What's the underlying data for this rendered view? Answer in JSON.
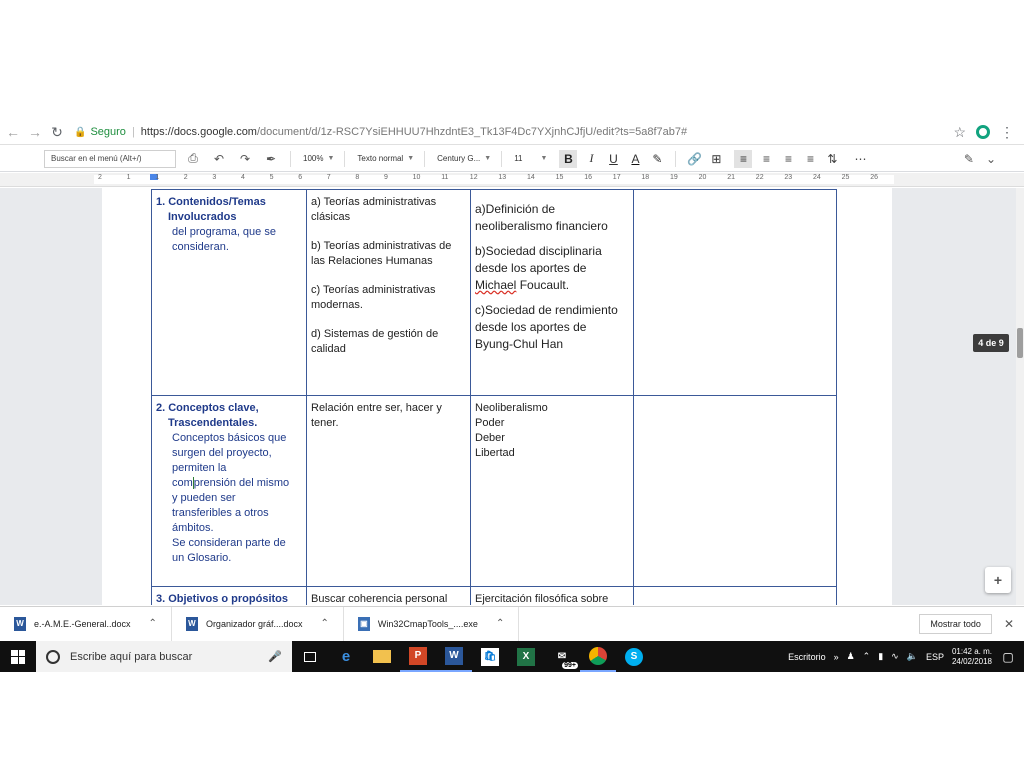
{
  "browser": {
    "secure_label": "Seguro",
    "url_prefix": "https://docs.google.com",
    "url_path": "/document/d/1z-RSC7YsiEHHUU7HhzdntE3_Tk13F4Dc7YXjnhCJfjU/edit?ts=5a8f7ab7#"
  },
  "toolbar": {
    "menu_search_placeholder": "Buscar en el menú (Alt+/)",
    "zoom": "100%",
    "style": "Texto normal",
    "font": "Century G...",
    "font_size": "11"
  },
  "ruler": {
    "ticks": [
      "2",
      "1",
      "1",
      "2",
      "3",
      "4",
      "5",
      "6",
      "7",
      "8",
      "9",
      "10",
      "11",
      "12",
      "13",
      "14",
      "15",
      "16",
      "17",
      "18",
      "19",
      "20",
      "21",
      "22",
      "23",
      "24",
      "25",
      "26"
    ]
  },
  "document": {
    "row1": {
      "col1_heading_1": "1. Contenidos/Temas",
      "col1_heading_2": "Involucrados",
      "col1_text_1": "del   programa,  que se",
      "col1_text_2": "consideran.",
      "col2_p1_l1": "a) Teorías administrativas",
      "col2_p1_l2": "clásicas",
      "col2_p2_l1": "b) Teorías administrativas de",
      "col2_p2_l2": "las Relaciones Humanas",
      "col2_p3_l1": "c) Teorías administrativas",
      "col2_p3_l2": "modernas.",
      "col2_p4_l1": "d) Sistemas de gestión de",
      "col2_p4_l2": "calidad",
      "col3_p1_l1": "a)Definición de",
      "col3_p1_l2": "neoliberalismo financiero",
      "col3_p2_l1": "b)Sociedad disciplinaria",
      "col3_p2_l2": "desde los aportes de",
      "col3_p2_l3a": "Michael",
      "col3_p2_l3b": " Foucault.",
      "col3_p3_l1": "c)Sociedad de rendimiento",
      "col3_p3_l2": "desde los aportes de",
      "col3_p3_l3": "Byung-Chul Han"
    },
    "row2": {
      "col1_heading_1": "2. Conceptos clave,",
      "col1_heading_2": "Trascendentales.",
      "col1_lines": [
        "Conceptos básicos que",
        "surgen  del proyecto,",
        "permiten la",
        "comprensión del mismo",
        "y  pueden ser",
        "transferibles a otros",
        "ámbitos.",
        "Se consideran parte de",
        "un  Glosario."
      ],
      "col2_l1": "Relación entre ser, hacer y",
      "col2_l2": "tener.",
      "col3_lines": [
        "Neoliberalismo",
        "Poder",
        "Deber",
        "Libertad"
      ]
    },
    "row3": {
      "col1_heading": "3.  Objetivos o propósitos",
      "col2_text": "Buscar coherencia personal",
      "col3_text": "Ejercitación filosófica sobre"
    }
  },
  "page_indicator": "4 de 9",
  "downloads": {
    "items": [
      {
        "name": "e.-A.M.E.-General..docx"
      },
      {
        "name": "Organizador gráf....docx"
      },
      {
        "name": "Win32CmapTools_....exe"
      }
    ],
    "show_all": "Mostrar todo"
  },
  "taskbar": {
    "search_placeholder": "Escribe aquí para buscar",
    "desktop_label": "Escritorio",
    "language": "ESP",
    "time": "01:42 a. m.",
    "date": "24/02/2018",
    "badge": "99+"
  }
}
